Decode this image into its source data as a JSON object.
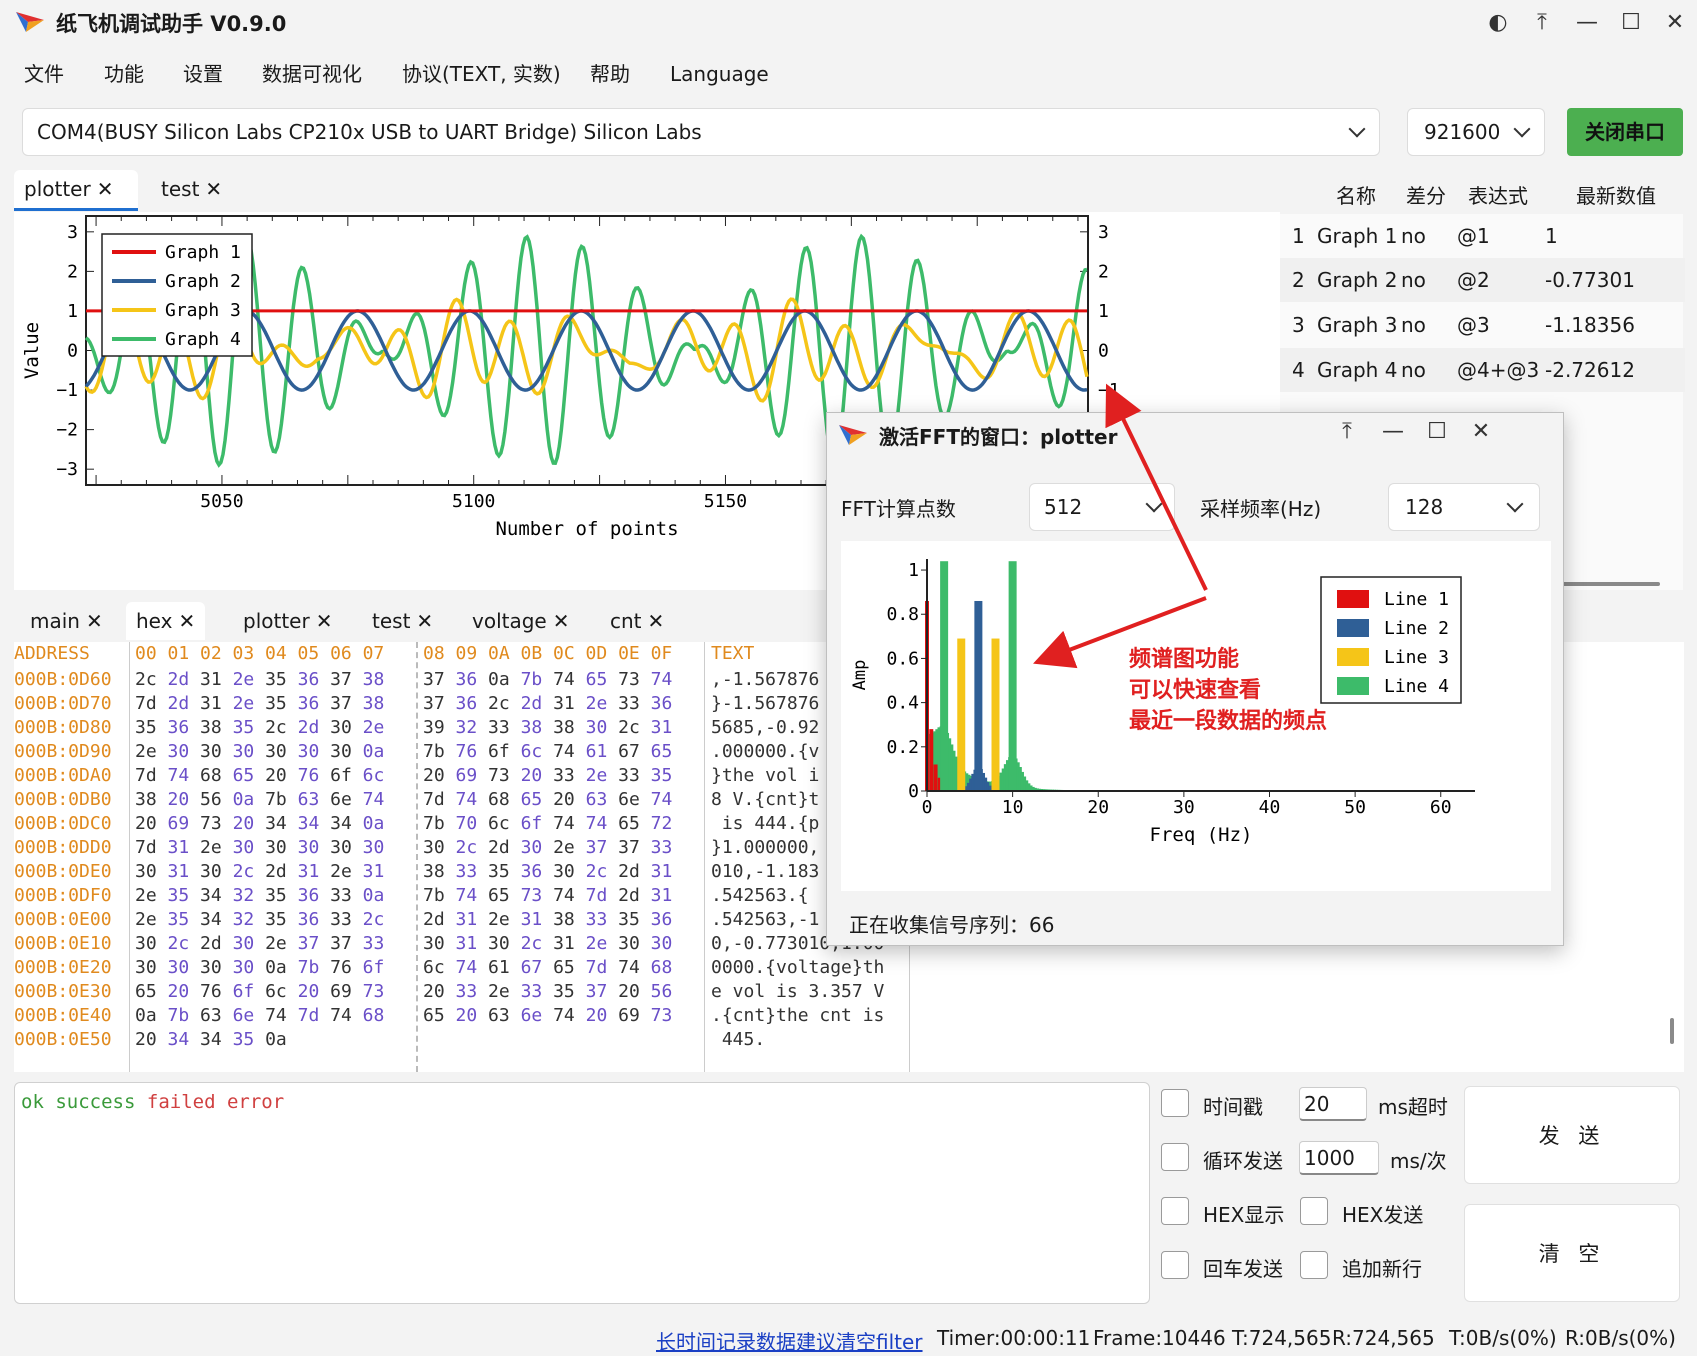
{
  "app": {
    "title": "纸飞机调试助手 V0.9.0"
  },
  "menu": [
    "文件",
    "功能",
    "设置",
    "数据可视化",
    "协议(TEXT, 实数)",
    "帮助",
    "Language"
  ],
  "port": {
    "selected": "COM4(BUSY  Silicon Labs CP210x USB to UART Bridge) Silicon Labs",
    "baud": "921600",
    "button": "关闭串口"
  },
  "plot_tabs": [
    {
      "label": "plotter"
    },
    {
      "label": "test"
    }
  ],
  "chart_data": {
    "type": "line",
    "xlabel": "Number of points",
    "ylabel": "Value",
    "xlim": [
      5023,
      5222
    ],
    "ylim": [
      -3.4,
      3.4
    ],
    "xticks": [
      "5050",
      "5100",
      "5150"
    ],
    "yticks": [
      "3",
      "2",
      "1",
      "0",
      "−1",
      "−2",
      "−3"
    ],
    "yticks_right": [
      "3",
      "2",
      "1",
      "0",
      "−1"
    ],
    "legend": "top-left",
    "series": [
      {
        "name": "Graph  1",
        "color": "#e01010",
        "values": "constant 1"
      },
      {
        "name": "Graph  2",
        "color": "#2f5f96",
        "values": "sine amplitude 1, period ~22"
      },
      {
        "name": "Graph  3",
        "color": "#f5c518",
        "values": "beat wave, peak ~1.4"
      },
      {
        "name": "Graph  4",
        "color": "#3dbb6a",
        "values": "beat wave, peak ~2.9"
      }
    ]
  },
  "var_table": {
    "headers": [
      "名称",
      "差分",
      "表达式",
      "最新数值"
    ],
    "rows": [
      {
        "idx": "1",
        "name": "Graph 1",
        "diff": "no",
        "expr": "@1",
        "val": "1"
      },
      {
        "idx": "2",
        "name": "Graph 2",
        "diff": "no",
        "expr": "@2",
        "val": "-0.77301"
      },
      {
        "idx": "3",
        "name": "Graph 3",
        "diff": "no",
        "expr": "@3",
        "val": "-1.18356"
      },
      {
        "idx": "4",
        "name": "Graph 4",
        "diff": "no",
        "expr": "@4+@3",
        "val": "-2.72612"
      }
    ]
  },
  "bottom_tabs": [
    "main",
    "hex",
    "plotter",
    "test",
    "voltage",
    "cnt"
  ],
  "hex": {
    "addr_header": "ADDRESS",
    "h1": "00 01 02 03 04 05 06 07",
    "h2": "08 09 0A 0B 0C 0D 0E 0F",
    "text_header": "TEXT",
    "rows": [
      {
        "addr": "000B:0D60",
        "a": "2c 2d 31 2e 35 36 37 38",
        "b": "37 36 0a 7b 74 65 73 74",
        "t": ",-1.567876"
      },
      {
        "addr": "000B:0D70",
        "a": "7d 2d 31 2e 35 36 37 38",
        "b": "37 36 2c 2d 31 2e 33 36",
        "t": "}-1.567876"
      },
      {
        "addr": "000B:0D80",
        "a": "35 36 38 35 2c 2d 30 2e",
        "b": "39 32 33 38 38 30 2c 31",
        "t": "5685,-0.92"
      },
      {
        "addr": "000B:0D90",
        "a": "2e 30 30 30 30 30 30 0a",
        "b": "7b 76 6f 6c 74 61 67 65",
        "t": ".000000.{v"
      },
      {
        "addr": "000B:0DA0",
        "a": "7d 74 68 65 20 76 6f 6c",
        "b": "20 69 73 20 33 2e 33 35",
        "t": "}the vol i"
      },
      {
        "addr": "000B:0DB0",
        "a": "38 20 56 0a 7b 63 6e 74",
        "b": "7d 74 68 65 20 63 6e 74",
        "t": "8 V.{cnt}t"
      },
      {
        "addr": "000B:0DC0",
        "a": "20 69 73 20 34 34 34 0a",
        "b": "7b 70 6c 6f 74 74 65 72",
        "t": " is 444.{p"
      },
      {
        "addr": "000B:0DD0",
        "a": "7d 31 2e 30 30 30 30 30",
        "b": "30 2c 2d 30 2e 37 37 33",
        "t": "}1.000000,"
      },
      {
        "addr": "000B:0DE0",
        "a": "30 31 30 2c 2d 31 2e 31",
        "b": "38 33 35 36 30 2c 2d 31",
        "t": "010,-1.183"
      },
      {
        "addr": "000B:0DF0",
        "a": "2e 35 34 32 35 36 33 0a",
        "b": "7b 74 65 73 74 7d 2d 31",
        "t": ".542563.{"
      },
      {
        "addr": "000B:0E00",
        "a": "2e 35 34 32 35 36 33 2c",
        "b": "2d 31 2e 31 38 33 35 36",
        "t": ".542563,-1"
      },
      {
        "addr": "000B:0E10",
        "a": "30 2c 2d 30 2e 37 37 33",
        "b": "30 31 30 2c 31 2e 30 30",
        "t": "0,-0.773010,1.00"
      },
      {
        "addr": "000B:0E20",
        "a": "30 30 30 30 0a 7b 76 6f",
        "b": "6c 74 61 67 65 7d 74 68",
        "t": "0000.{voltage}th"
      },
      {
        "addr": "000B:0E30",
        "a": "65 20 76 6f 6c 20 69 73",
        "b": "20 33 2e 33 35 37 20 56",
        "t": "e vol is 3.357 V"
      },
      {
        "addr": "000B:0E40",
        "a": "0a 7b 63 6e 74 7d 74 68",
        "b": "65 20 63 6e 74 20 69 73",
        "t": ".{cnt}the cnt is"
      },
      {
        "addr": "000B:0E50",
        "a": "20 34 34 35 0a",
        "b": "",
        "t": " 445."
      }
    ]
  },
  "console": {
    "ok": "ok",
    "success": "success",
    "failed": "failed",
    "error": "error"
  },
  "options": {
    "timestamp": "时间戳",
    "timeout_value": "20",
    "timeout_unit": "ms超时",
    "loop_send": "循环发送",
    "loop_value": "1000",
    "loop_unit": "ms/次",
    "hex_show": "HEX显示",
    "hex_send": "HEX发送",
    "crlf_send": "回车发送",
    "append_newline": "追加新行",
    "send_btn": "发 送",
    "clear_btn": "清 空"
  },
  "status": {
    "link": "长时间记录数据建议清空filter",
    "timer": "Timer:00:00:11",
    "frame": "Frame:10446",
    "t": "T:724,565",
    "r": "R:724,565",
    "trate": "T:0B/s(0%)",
    "rrate": "R:0B/s(0%)"
  },
  "fft": {
    "title": "激活FFT的窗口：plotter",
    "points_label": "FFT计算点数",
    "points_value": "512",
    "rate_label": "采样频率(Hz)",
    "rate_value": "128",
    "collecting": "正在收集信号序列：66",
    "annotation": [
      "频谱图功能",
      "可以快速查看",
      "最近一段数据的频点"
    ],
    "chart_data": {
      "type": "bar",
      "xlabel": "Freq (Hz)",
      "ylabel": "Amp",
      "xlim": [
        0,
        64
      ],
      "ylim": [
        0,
        1.05
      ],
      "xticks": [
        "0",
        "10",
        "20",
        "30",
        "40",
        "50",
        "60"
      ],
      "yticks": [
        "0",
        "0.2",
        "0.4",
        "0.6",
        "0.8",
        "1"
      ],
      "legend": "top-right",
      "series": [
        {
          "name": "Line  1",
          "color": "#e01010",
          "peaks": [
            [
              0,
              0.86
            ]
          ]
        },
        {
          "name": "Line  2",
          "color": "#2f5f96",
          "peaks": [
            [
              6,
              0.86
            ]
          ]
        },
        {
          "name": "Line  3",
          "color": "#f5c518",
          "peaks": [
            [
              4,
              0.69
            ],
            [
              8,
              0.69
            ]
          ]
        },
        {
          "name": "Line  4",
          "color": "#3dbb6a",
          "peaks": [
            [
              2,
              1.04
            ],
            [
              10,
              1.04
            ]
          ]
        }
      ]
    }
  },
  "colors": {
    "accent_green": "#4caf50",
    "arrow_red": "#e02020",
    "link_blue": "#1a3fc4",
    "hex_purple": "#6a4fc8",
    "hex_header": "#e08a1e"
  }
}
